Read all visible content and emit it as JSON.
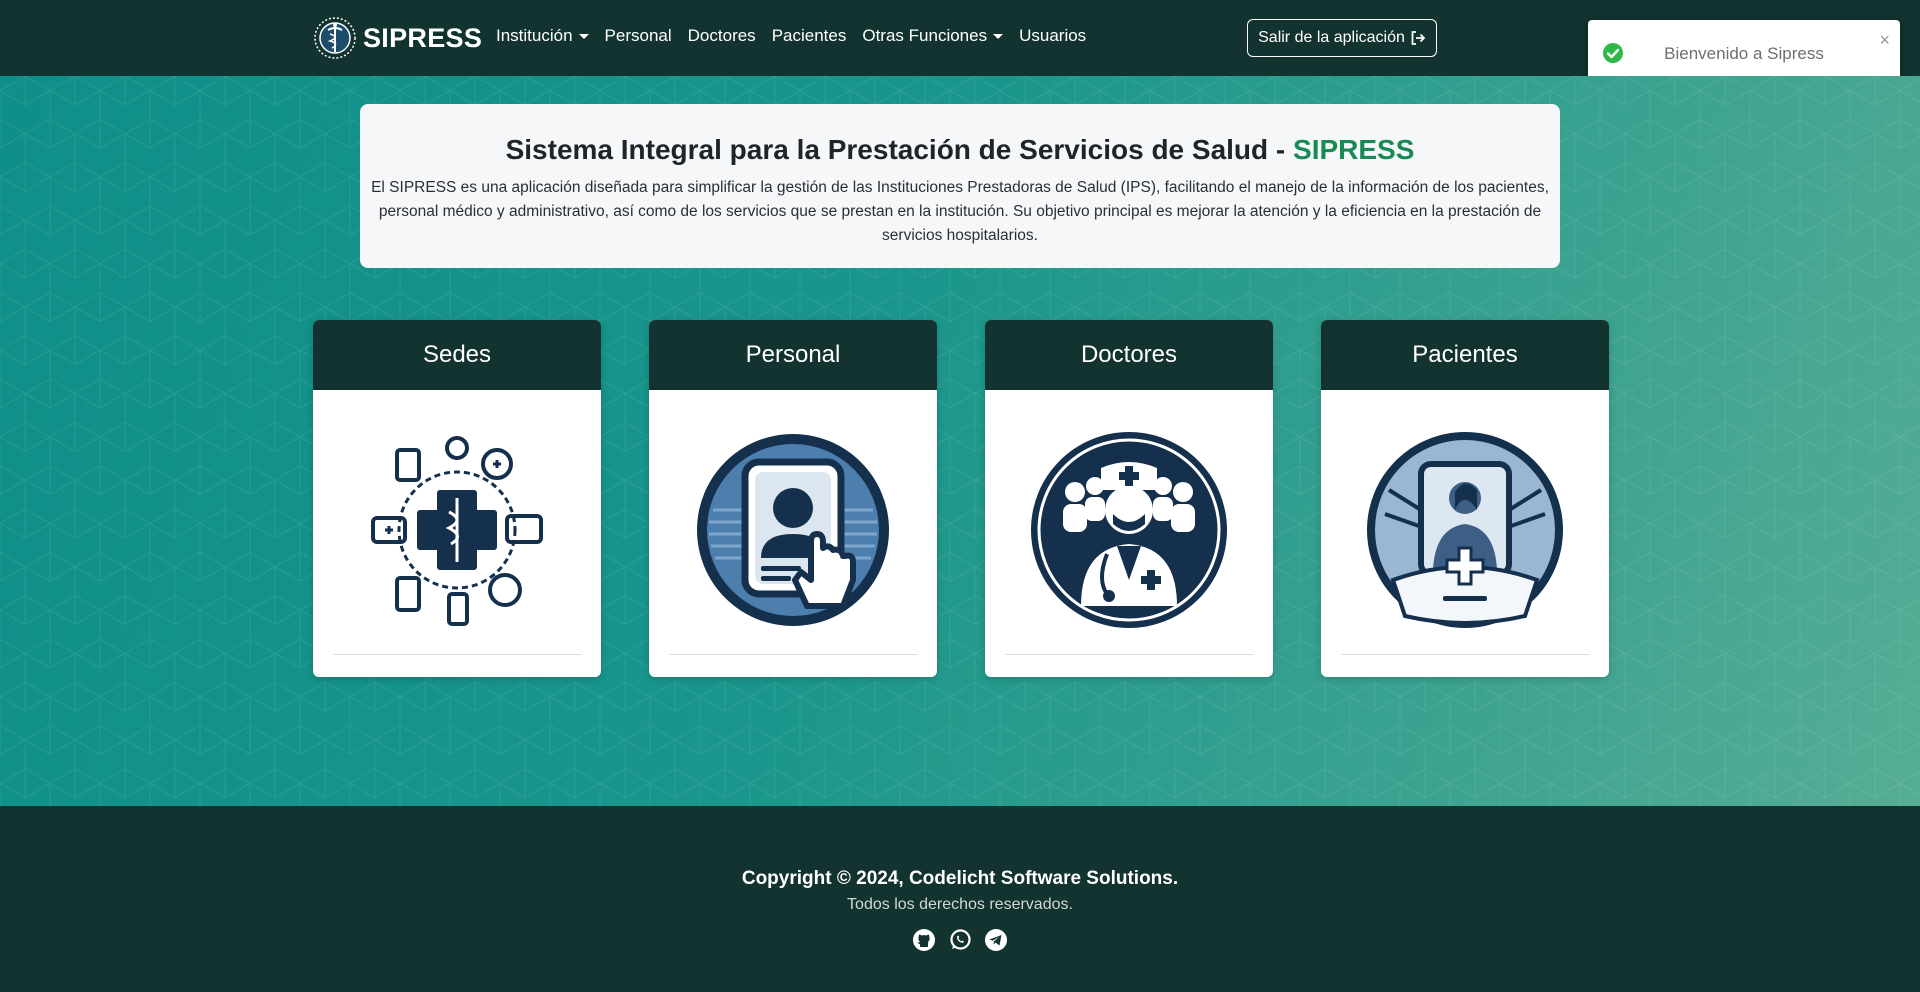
{
  "navbar": {
    "brand": "SIPRESS",
    "links": [
      {
        "label": "Institución",
        "dropdown": true
      },
      {
        "label": "Personal",
        "dropdown": false
      },
      {
        "label": "Doctores",
        "dropdown": false
      },
      {
        "label": "Pacientes",
        "dropdown": false
      },
      {
        "label": "Otras Funciones",
        "dropdown": true
      },
      {
        "label": "Usuarios",
        "dropdown": false
      }
    ],
    "logout_label": "Salir de la aplicación"
  },
  "toast": {
    "message": "Bienvenido a Sipress",
    "close": "×",
    "progress_fraction": 0.24
  },
  "intro": {
    "title": "Sistema Integral para la Prestación de Servicios de Salud - ",
    "title_accent": "SIPRESS",
    "description": "El SIPRESS es una aplicación diseñada para simplificar la gestión de las Instituciones Prestadoras de Salud (IPS), facilitando el manejo de la información de los pacientes, personal médico y administrativo, así como de los servicios que se prestan en la institución. Su objetivo principal es mejorar la atención y la eficiencia en la prestación de servicios hospitalarios."
  },
  "cards": [
    {
      "title": "Sedes",
      "icon": "medical-collage-icon"
    },
    {
      "title": "Personal",
      "icon": "staff-badge-icon"
    },
    {
      "title": "Doctores",
      "icon": "doctor-team-icon"
    },
    {
      "title": "Pacientes",
      "icon": "patient-icon"
    }
  ],
  "footer": {
    "copyright": "Copyright © 2024, Codelicht Software Solutions.",
    "rights": "Todos los derechos reservados.",
    "socials": [
      "github-icon",
      "whatsapp-icon",
      "telegram-icon"
    ]
  },
  "colors": {
    "navbar": "#12332f",
    "accent_green": "#1a8a55",
    "toast_success": "#2eb84a",
    "icon_navy": "#15304d",
    "icon_blue": "#4d7fae"
  }
}
